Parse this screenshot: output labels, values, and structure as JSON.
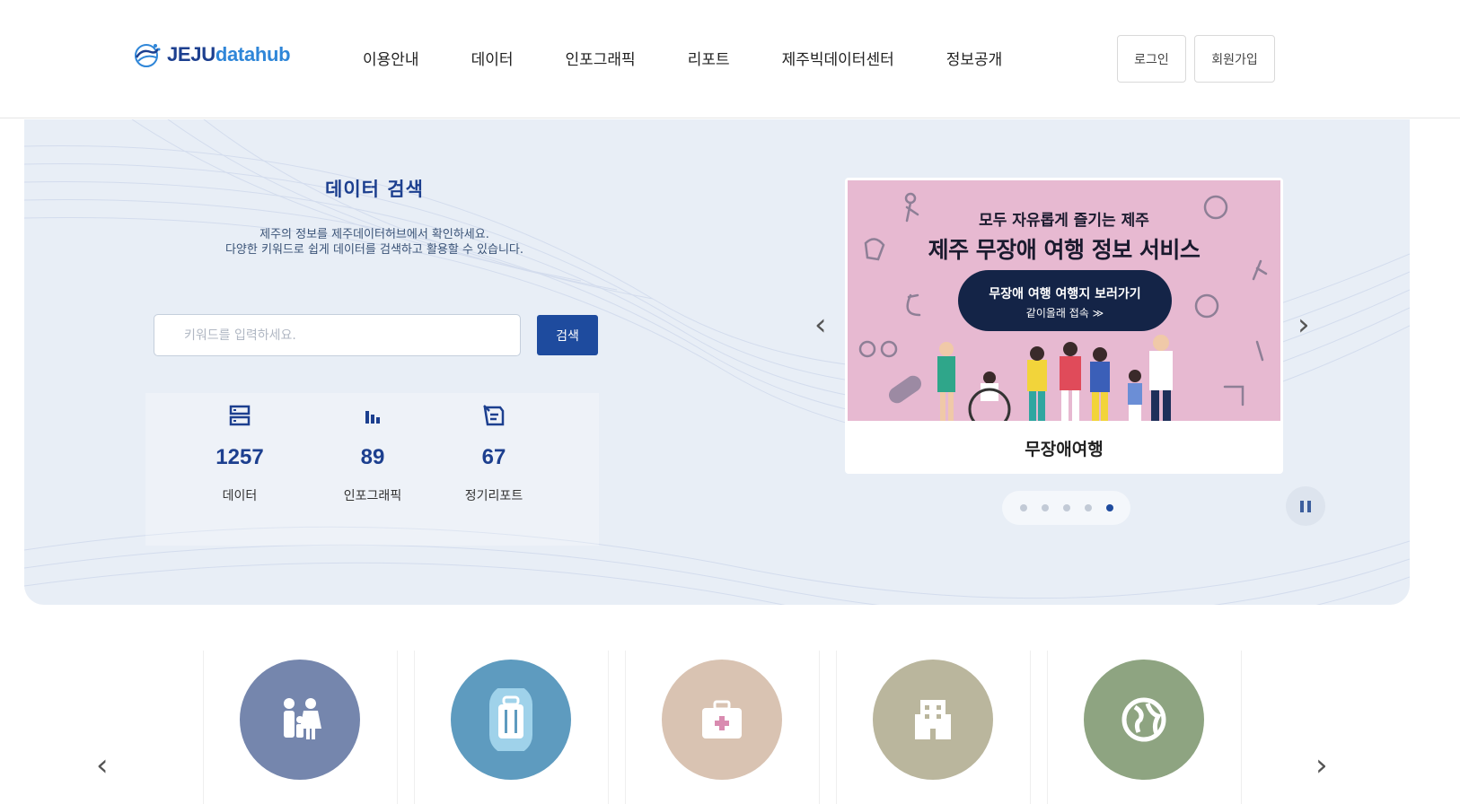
{
  "logo": {
    "part1": "JEJU",
    "part2": "datahub"
  },
  "nav": [
    "이용안내",
    "데이터",
    "인포그래픽",
    "리포트",
    "제주빅데이터센터",
    "정보공개"
  ],
  "auth": {
    "login": "로그인",
    "signup": "회원가입"
  },
  "search": {
    "title": "데이터 검색",
    "desc_line1": "제주의 정보를 제주데이터허브에서 확인하세요.",
    "desc_line2": "다양한 키워드로 쉽게 데이터를 검색하고 활용할 수 있습니다.",
    "placeholder": "키워드를 입력하세요.",
    "button": "검색"
  },
  "stats": [
    {
      "icon": "database-icon",
      "value": "1257",
      "label": "데이터"
    },
    {
      "icon": "bar-chart-icon",
      "value": "89",
      "label": "인포그래픽"
    },
    {
      "icon": "report-icon",
      "value": "67",
      "label": "정기리포트"
    }
  ],
  "slider": {
    "banner_sub": "모두 자유롭게 즐기는 제주",
    "banner_title": "제주 무장애 여행 정보 서비스",
    "pill_main": "무장애 여행 여행지 보러가기",
    "pill_sub": "같이올래 접속 ≫",
    "caption": "무장애여행",
    "dots": 5,
    "active_dot": 5,
    "prev": "‹",
    "next": "›"
  },
  "categories": [
    {
      "icon": "family-icon",
      "color": "#6f83ad"
    },
    {
      "icon": "luggage-icon",
      "color": "#5e9bbf"
    },
    {
      "icon": "medical-kit-icon",
      "color": "#d9b7aa"
    },
    {
      "icon": "building-icon",
      "color": "#b9b59a"
    },
    {
      "icon": "globe-icon",
      "color": "#8ba27f"
    }
  ],
  "colors": {
    "brand": "#1e4b9e",
    "hero_bg": "#e8eef6",
    "banner_bg": "#e7b9d1"
  }
}
